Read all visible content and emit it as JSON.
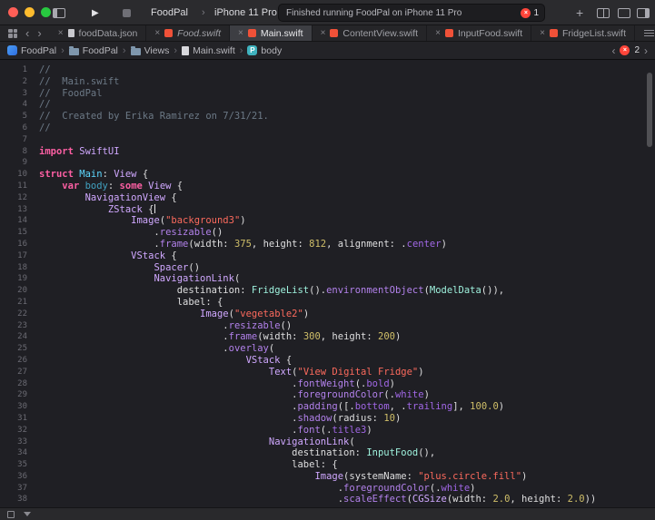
{
  "glyphs": {
    "close": "×",
    "separator": "›",
    "back": "‹",
    "forward": "›",
    "plus": "+",
    "play": "▶",
    "error_x": "×"
  },
  "colors": {
    "error_red": "#ff453a",
    "swift_orange": "#f05138",
    "keyword_pink": "#fc5fa3",
    "string_red": "#fc6a5d",
    "number_yellow": "#d0bf69",
    "comment_gray": "#6c7986",
    "type_cyan": "#5dd8ff",
    "system_type_lavender": "#d0a8ff",
    "project_type_mint": "#9ef1dd"
  },
  "toolbar": {
    "scheme": "FoodPal",
    "device": "iPhone 11 Pro",
    "status_text": "Finished running FoodPal on iPhone 11 Pro",
    "error_count": "1"
  },
  "tabs": [
    {
      "label": "foodData.json",
      "kind": "json"
    },
    {
      "label": "Food.swift",
      "kind": "swift"
    },
    {
      "label": "Main.swift",
      "kind": "swift"
    },
    {
      "label": "ContentView.swift",
      "kind": "swift"
    },
    {
      "label": "InputFood.swift",
      "kind": "swift"
    },
    {
      "label": "FridgeList.swift",
      "kind": "swift"
    }
  ],
  "jumpbar": {
    "items": [
      {
        "label": "FoodPal",
        "icon": "project-icon"
      },
      {
        "label": "FoodPal",
        "icon": "folder-icon"
      },
      {
        "label": "Views",
        "icon": "folder-icon"
      },
      {
        "label": "Main.swift",
        "icon": "swift-file-icon"
      },
      {
        "label": "body",
        "icon": "property-icon"
      }
    ],
    "property_badge": "P",
    "error_count": "2"
  },
  "editor": {
    "caret_line": 13,
    "lines": [
      [
        [
          "c",
          "//"
        ]
      ],
      [
        [
          "c",
          "//  Main.swift"
        ]
      ],
      [
        [
          "c",
          "//  FoodPal"
        ]
      ],
      [
        [
          "c",
          "//"
        ]
      ],
      [
        [
          "c",
          "//  Created by Erika Ramirez on 7/31/21."
        ]
      ],
      [
        [
          "c",
          "//"
        ]
      ],
      [],
      [
        [
          "k",
          "import"
        ],
        [
          "p",
          " "
        ],
        [
          "t",
          "SwiftUI"
        ]
      ],
      [],
      [
        [
          "k",
          "struct"
        ],
        [
          "p",
          " "
        ],
        [
          "td",
          "Main"
        ],
        [
          "p",
          ": "
        ],
        [
          "t",
          "View"
        ],
        [
          "p",
          " {"
        ]
      ],
      [
        [
          "p",
          "    "
        ],
        [
          "k",
          "var"
        ],
        [
          "p",
          " "
        ],
        [
          "d",
          "body"
        ],
        [
          "p",
          ": "
        ],
        [
          "k",
          "some"
        ],
        [
          "p",
          " "
        ],
        [
          "t",
          "View"
        ],
        [
          "p",
          " {"
        ]
      ],
      [
        [
          "p",
          "        "
        ],
        [
          "t",
          "NavigationView"
        ],
        [
          "p",
          " {"
        ]
      ],
      [
        [
          "p",
          "            "
        ],
        [
          "t",
          "ZStack"
        ],
        [
          "p",
          " {"
        ]
      ],
      [
        [
          "p",
          "                "
        ],
        [
          "t",
          "Image"
        ],
        [
          "p",
          "("
        ],
        [
          "s",
          "\"background3\""
        ],
        [
          "p",
          ")"
        ]
      ],
      [
        [
          "p",
          "                    ."
        ],
        [
          "f",
          "resizable"
        ],
        [
          "p",
          "()"
        ]
      ],
      [
        [
          "p",
          "                    ."
        ],
        [
          "f",
          "frame"
        ],
        [
          "p",
          "(width: "
        ],
        [
          "n",
          "375"
        ],
        [
          "p",
          ", height: "
        ],
        [
          "n",
          "812"
        ],
        [
          "p",
          ", alignment: ."
        ],
        [
          "e",
          "center"
        ],
        [
          "p",
          ")"
        ]
      ],
      [
        [
          "p",
          "                "
        ],
        [
          "t",
          "VStack"
        ],
        [
          "p",
          " {"
        ]
      ],
      [
        [
          "p",
          "                    "
        ],
        [
          "t",
          "Spacer"
        ],
        [
          "p",
          "()"
        ]
      ],
      [
        [
          "p",
          "                    "
        ],
        [
          "t",
          "NavigationLink"
        ],
        [
          "p",
          "("
        ]
      ],
      [
        [
          "p",
          "                        destination: "
        ],
        [
          "pt",
          "FridgeList"
        ],
        [
          "p",
          "()."
        ],
        [
          "f",
          "environmentObject"
        ],
        [
          "p",
          "("
        ],
        [
          "pt",
          "ModelData"
        ],
        [
          "p",
          "()),"
        ]
      ],
      [
        [
          "p",
          "                        label: {"
        ]
      ],
      [
        [
          "p",
          "                            "
        ],
        [
          "t",
          "Image"
        ],
        [
          "p",
          "("
        ],
        [
          "s",
          "\"vegetable2\""
        ],
        [
          "p",
          ")"
        ]
      ],
      [
        [
          "p",
          "                                ."
        ],
        [
          "f",
          "resizable"
        ],
        [
          "p",
          "()"
        ]
      ],
      [
        [
          "p",
          "                                ."
        ],
        [
          "f",
          "frame"
        ],
        [
          "p",
          "(width: "
        ],
        [
          "n",
          "300"
        ],
        [
          "p",
          ", height: "
        ],
        [
          "n",
          "200"
        ],
        [
          "p",
          ")"
        ]
      ],
      [
        [
          "p",
          "                                ."
        ],
        [
          "f",
          "overlay"
        ],
        [
          "p",
          "("
        ]
      ],
      [
        [
          "p",
          "                                    "
        ],
        [
          "t",
          "VStack"
        ],
        [
          "p",
          " {"
        ]
      ],
      [
        [
          "p",
          "                                        "
        ],
        [
          "t",
          "Text"
        ],
        [
          "p",
          "("
        ],
        [
          "s",
          "\"View Digital Fridge\""
        ],
        [
          "p",
          ")"
        ]
      ],
      [
        [
          "p",
          "                                            ."
        ],
        [
          "f",
          "fontWeight"
        ],
        [
          "p",
          "(."
        ],
        [
          "e",
          "bold"
        ],
        [
          "p",
          ")"
        ]
      ],
      [
        [
          "p",
          "                                            ."
        ],
        [
          "f",
          "foregroundColor"
        ],
        [
          "p",
          "(."
        ],
        [
          "e",
          "white"
        ],
        [
          "p",
          ")"
        ]
      ],
      [
        [
          "p",
          "                                            ."
        ],
        [
          "f",
          "padding"
        ],
        [
          "p",
          "([."
        ],
        [
          "e",
          "bottom"
        ],
        [
          "p",
          ", ."
        ],
        [
          "e",
          "trailing"
        ],
        [
          "p",
          "], "
        ],
        [
          "n",
          "100.0"
        ],
        [
          "p",
          ")"
        ]
      ],
      [
        [
          "p",
          "                                            ."
        ],
        [
          "f",
          "shadow"
        ],
        [
          "p",
          "(radius: "
        ],
        [
          "n",
          "10"
        ],
        [
          "p",
          ")"
        ]
      ],
      [
        [
          "p",
          "                                            ."
        ],
        [
          "f",
          "font"
        ],
        [
          "p",
          "(."
        ],
        [
          "e",
          "title3"
        ],
        [
          "p",
          ")"
        ]
      ],
      [
        [
          "p",
          "                                        "
        ],
        [
          "t",
          "NavigationLink"
        ],
        [
          "p",
          "("
        ]
      ],
      [
        [
          "p",
          "                                            destination: "
        ],
        [
          "pt",
          "InputFood"
        ],
        [
          "p",
          "(),"
        ]
      ],
      [
        [
          "p",
          "                                            label: {"
        ]
      ],
      [
        [
          "p",
          "                                                "
        ],
        [
          "t",
          "Image"
        ],
        [
          "p",
          "(systemName: "
        ],
        [
          "s",
          "\"plus.circle.fill\""
        ],
        [
          "p",
          ")"
        ]
      ],
      [
        [
          "p",
          "                                                    ."
        ],
        [
          "f",
          "foregroundColor"
        ],
        [
          "p",
          "(."
        ],
        [
          "e",
          "white"
        ],
        [
          "p",
          ")"
        ]
      ],
      [
        [
          "p",
          "                                                    ."
        ],
        [
          "f",
          "scaleEffect"
        ],
        [
          "p",
          "("
        ],
        [
          "t",
          "CGSize"
        ],
        [
          "p",
          "(width: "
        ],
        [
          "n",
          "2.0"
        ],
        [
          "p",
          ", height: "
        ],
        [
          "n",
          "2.0"
        ],
        [
          "p",
          "))"
        ]
      ]
    ]
  }
}
